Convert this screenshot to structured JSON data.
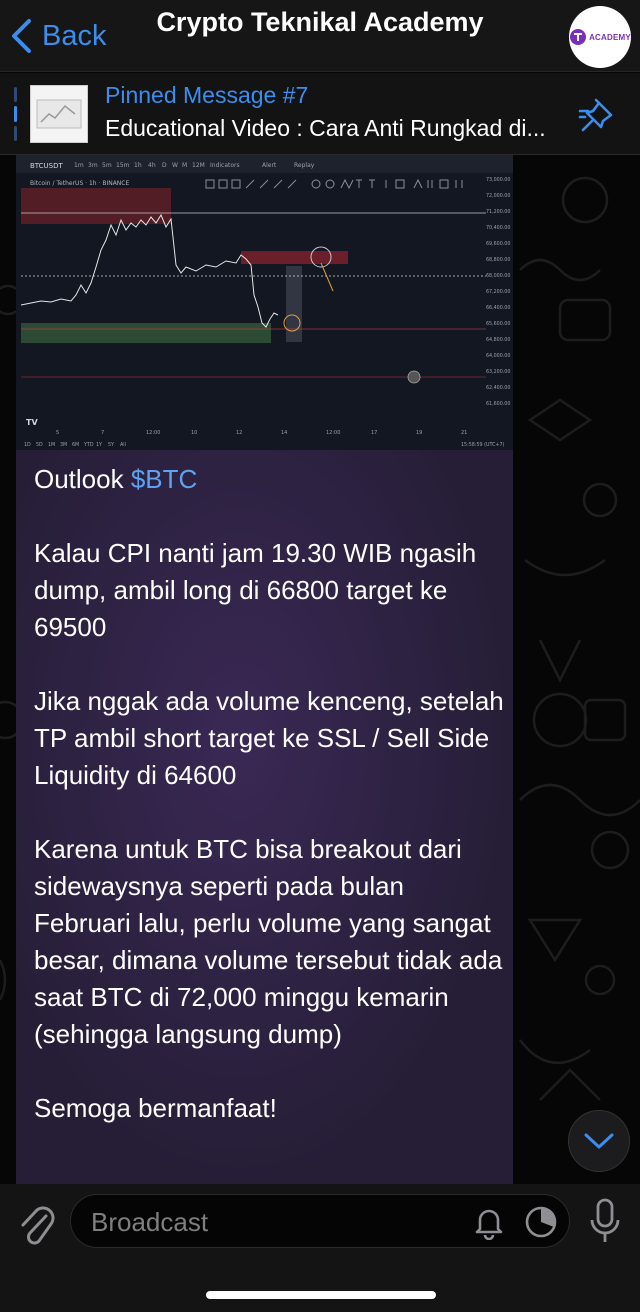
{
  "header": {
    "back_label": "Back",
    "title": "Crypto Teknikal Academy",
    "avatar_text": "ACADEMY"
  },
  "pinned": {
    "title": "Pinned Message #7",
    "text": "Educational Video : Cara Anti Rungkad di..."
  },
  "message": {
    "image": {
      "symbol": "BTCUSDT",
      "pair_label": "Bitcoin / TetherUS · 1h · BINANCE",
      "toolbar_items": [
        "1m",
        "3m",
        "5m",
        "15m",
        "1h",
        "4h",
        "D",
        "W",
        "M",
        "12M",
        "Indicators",
        "Alert",
        "Replay"
      ],
      "price_levels": [
        "73,000.00",
        "72,000.00",
        "71,200.00",
        "70,400.00",
        "69,600.00",
        "68,800.00",
        "68,000.00",
        "67,200.00",
        "66,400.00",
        "65,600.00",
        "64,800.00",
        "64,000.00",
        "63,200.00",
        "62,400.00",
        "61,600.00"
      ],
      "time_labels": [
        "5",
        "7",
        "12:00",
        "10",
        "12",
        "14",
        "12:00",
        "17",
        "19",
        "21"
      ],
      "range_buttons": [
        "1D",
        "5D",
        "1M",
        "3M",
        "6M",
        "YTD",
        "1Y",
        "5Y",
        "All"
      ],
      "clock": "15:58:59 (UTC+7)",
      "logo": "TV"
    },
    "hashtag_prefix": "Outlook ",
    "hashtag": "$BTC",
    "paragraphs": [
      "Kalau CPI nanti jam 19.30 WIB ngasih dump, ambil long di 66800 target ke 69500",
      "Jika nggak ada volume kenceng, setelah TP ambil short target ke SSL / Sell Side Liquidity di 64600",
      "Karena untuk BTC bisa breakout dari sidewaysnya seperti pada bulan Februari lalu, perlu volume yang sangat besar, dimana volume tersebut tidak ada saat BTC di 72,000 minggu kemarin (sehingga langsung dump)",
      "Semoga bermanfaat!"
    ]
  },
  "input": {
    "placeholder": "Broadcast"
  },
  "colors": {
    "accent": "#3b8ef0",
    "bubble": "#261e37",
    "header": "#161616"
  },
  "icons": [
    "back-chevron-icon",
    "pin-icon",
    "attach-icon",
    "bell-icon",
    "timer-icon",
    "mic-icon",
    "chevron-down-icon"
  ]
}
